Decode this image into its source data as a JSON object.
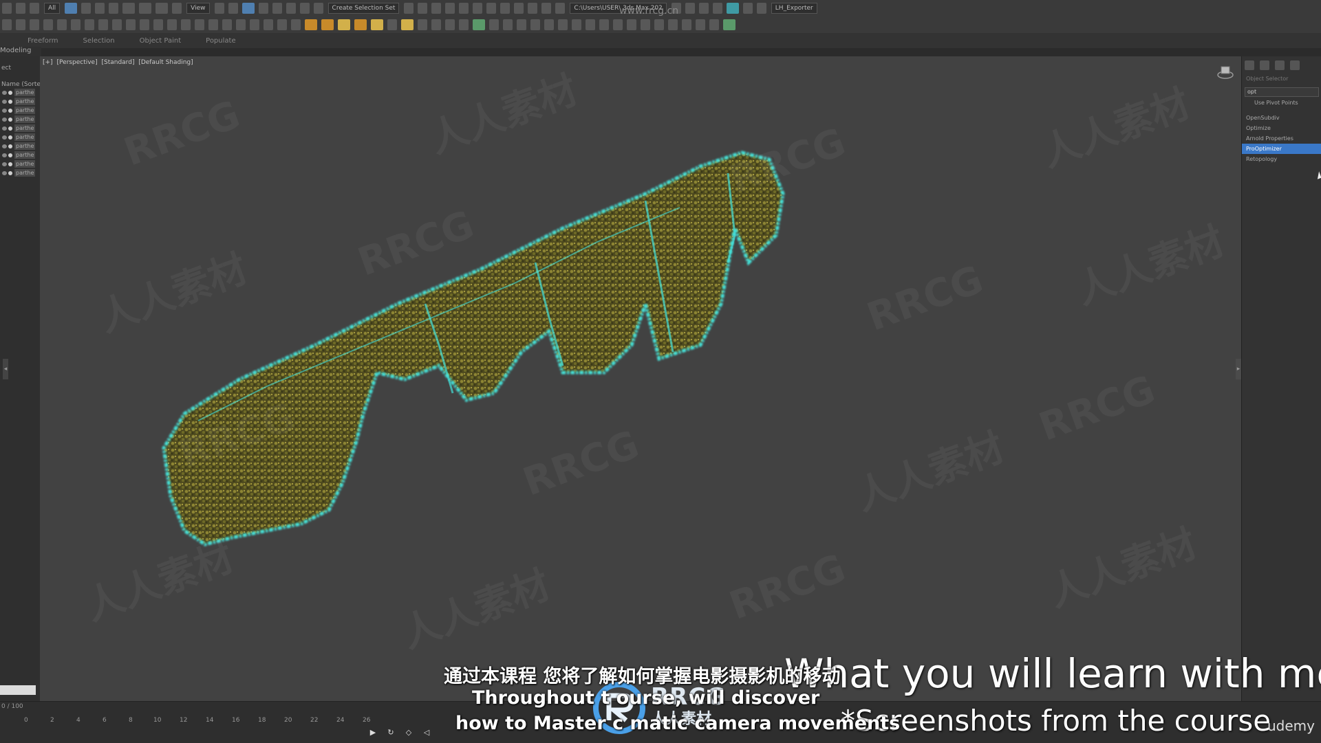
{
  "toolbar": {
    "filter_dropdown": "All",
    "view_dropdown": "View",
    "selection_set_dropdown": "Create Selection Set",
    "project_path": "C:\\Users\\USER\\ 3ds Max 202",
    "exporter_label": "LH_Exporter"
  },
  "ribbon": {
    "tabs": [
      "Freeform",
      "Selection",
      "Object Paint",
      "Populate"
    ],
    "mode_label": "Modeling"
  },
  "scene_explorer": {
    "title": "Name (Sorted A",
    "label_ect": "ect",
    "items": [
      "parthe",
      "parthe",
      "parthe",
      "parthe",
      "parthe",
      "parthe",
      "parthe",
      "parthe",
      "parthe",
      "parthe"
    ]
  },
  "viewport": {
    "labels": [
      "[+]",
      "[Perspective]",
      "[Standard]",
      "[Default Shading]"
    ],
    "colors": {
      "bg": "#424242",
      "foliage": "#6b6a2a",
      "outline": "#45e0d8"
    }
  },
  "command_panel": {
    "section": "Object Selector",
    "search_value": "opt",
    "checkbox_label": "Use Pivot Points",
    "modifiers": [
      "OpenSubdiv",
      "Optimize",
      "Arnold Properties",
      "ProOptimizer",
      "Retopology"
    ],
    "selected_index": 3
  },
  "timeline": {
    "frame_label": "0 / 100",
    "ticks": [
      "0",
      "2",
      "4",
      "6",
      "8",
      "10",
      "12",
      "14",
      "16",
      "18",
      "20",
      "22",
      "24",
      "26"
    ]
  },
  "subtitles": {
    "cn": "通过本课程 您将了解如何掌握电影摄影机的移动",
    "en_line1": "Throughout t      ourse,      will discover",
    "en_line2": "how to Master c    matic camera movements"
  },
  "overlay": {
    "course_title": "What you will learn with me",
    "course_subtitle": "*Screenshots from the course",
    "udemy": "udemy",
    "logo_text": "RRCG",
    "logo_subtext": "人人素材",
    "site_url": "www.rrcg.cn"
  },
  "watermarks": [
    "RRCG",
    "人人素材"
  ]
}
